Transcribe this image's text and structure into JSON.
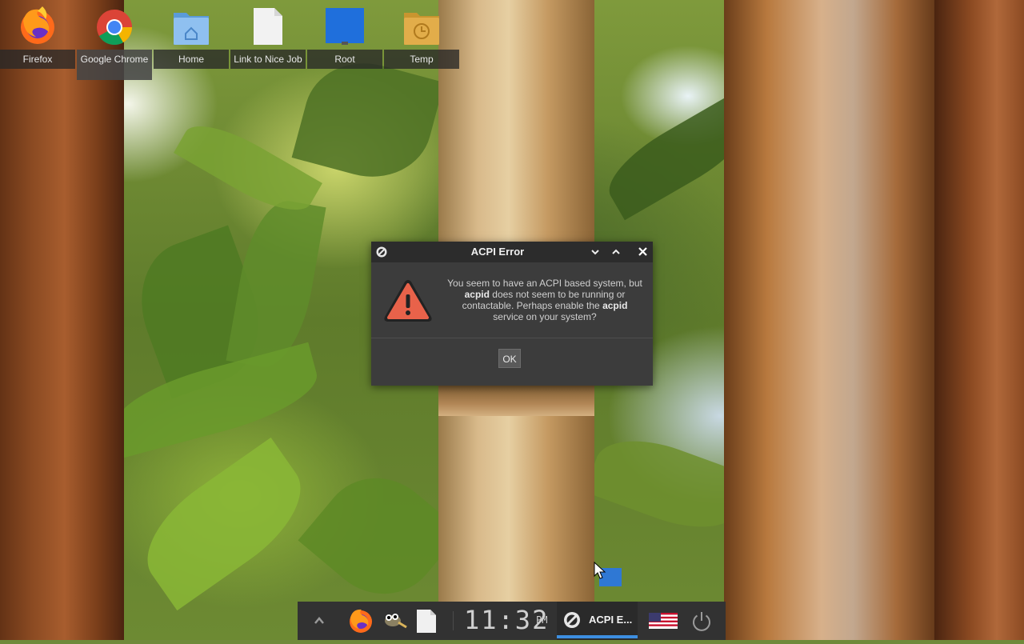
{
  "desktop": {
    "icons": [
      {
        "label": "Firefox",
        "icon": "firefox-icon"
      },
      {
        "label": "Google Chrome",
        "icon": "chrome-icon"
      },
      {
        "label": "Home",
        "icon": "home-folder-icon"
      },
      {
        "label": "Link to Nice Job",
        "icon": "file-icon"
      },
      {
        "label": "Root",
        "icon": "drive-icon"
      },
      {
        "label": "Temp",
        "icon": "clock-folder-icon"
      }
    ]
  },
  "dialog": {
    "title": "ACPI Error",
    "icon": "warning-icon",
    "message_1": "You seem to have an ACPI based system, but",
    "message_2_bold": "acpid",
    "message_2": " does not seem to be running or",
    "message_3": "contactable. Perhaps enable the ",
    "message_3_bold": "acpid",
    "message_4": "service on your system?",
    "ok_label": "OK",
    "buttons": [
      "minimize-icon",
      "maximize-icon",
      "close-icon"
    ]
  },
  "taskbar": {
    "launchers": [
      "up-arrow-icon",
      "firefox-icon",
      "gimp-icon",
      "file-icon"
    ],
    "clock": {
      "time": "11:32",
      "ampm": "PM"
    },
    "task": {
      "label": "ACPI E..."
    },
    "tray": [
      "us-flag-icon",
      "power-icon"
    ],
    "colors": {
      "bar": "#323232",
      "active_underline": "#3d8ee0"
    }
  }
}
